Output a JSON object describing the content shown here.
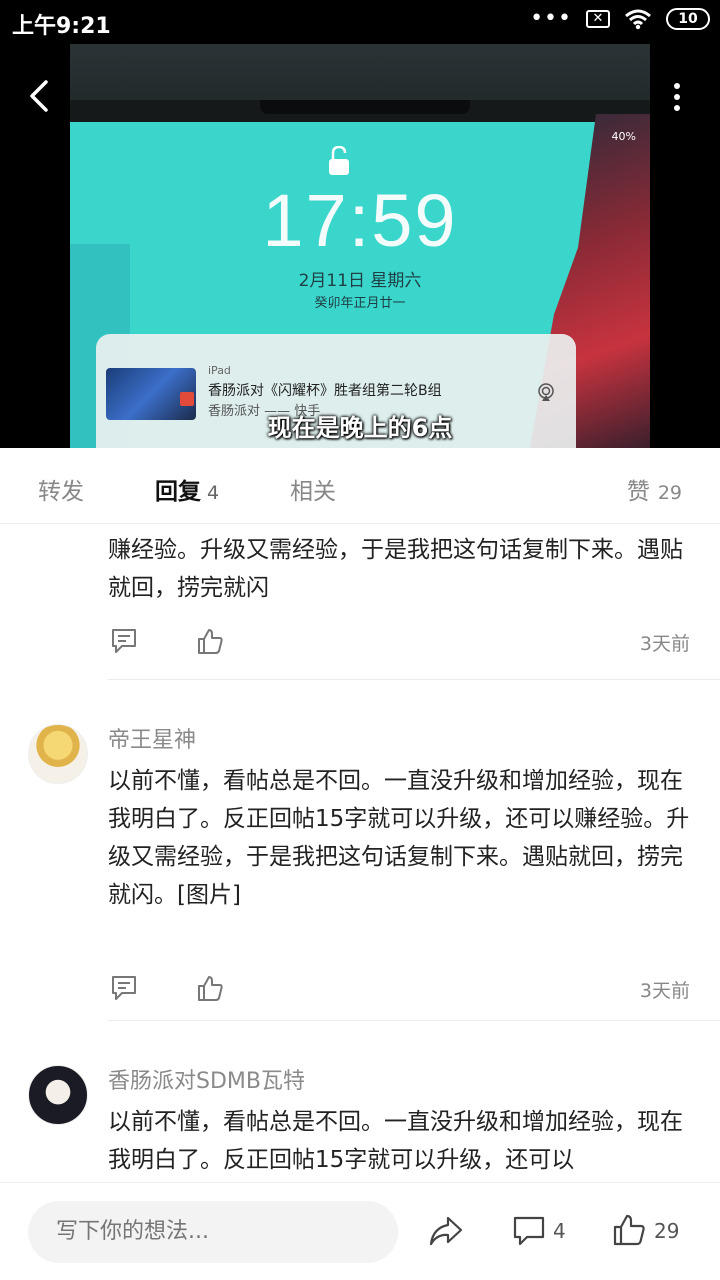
{
  "status_bar": {
    "time": "上午9:21",
    "dots": "•••",
    "battery": "10"
  },
  "video": {
    "lock_time": "17:59",
    "lock_date": "2月11日 星期六",
    "lock_lunar": "癸卯年正月廿一",
    "battery_pct": "40%",
    "notification": {
      "app": "iPad",
      "title": "香肠派对《闪耀杯》胜者组第二轮B组",
      "subtitle": "香肠派对 —— 快手"
    },
    "caption": "现在是晚上的6点"
  },
  "tabs": {
    "repost": "转发",
    "reply": "回复",
    "reply_count": "4",
    "related": "相关",
    "like": "赞",
    "like_count": "29"
  },
  "comments": [
    {
      "text": "赚经验。升级又需经验，于是我把这句话复制下来。遇贴就回，捞完就闪",
      "ago": "3天前"
    },
    {
      "name": "帝王星神",
      "text": "以前不懂，看帖总是不回。一直没升级和增加经验，现在我明白了。反正回帖15字就可以升级，还可以赚经验。升级又需经验，于是我把这句话复制下来。遇贴就回，捞完就闪。[图片]",
      "ago": "3天前"
    },
    {
      "name": "香肠派对SDMB瓦特",
      "text": "以前不懂，看帖总是不回。一直没升级和增加经验，现在我明白了。反正回帖15字就可以升级，还可以"
    }
  ],
  "bottom_bar": {
    "placeholder": "写下你的想法...",
    "comment_count": "4",
    "like_count": "29"
  }
}
